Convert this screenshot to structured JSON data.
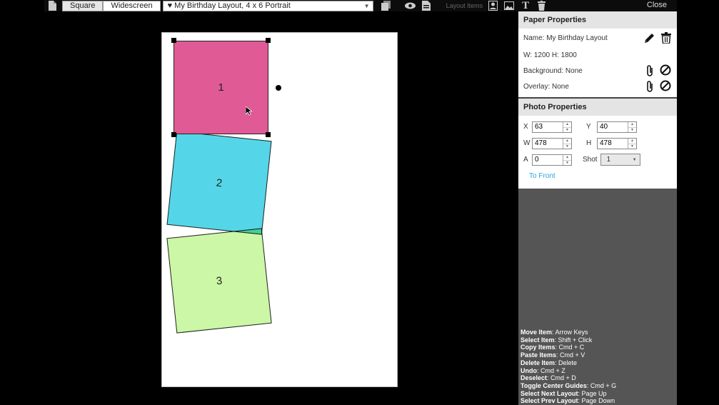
{
  "toolbar": {
    "square_label": "Square",
    "widescreen_label": "Widescreen",
    "layout_selected": "♥ My Birthday Layout, 4 x 6 Portrait",
    "layout_items_label": "Layout Items",
    "close_label": "Close"
  },
  "photos": [
    {
      "number": "1",
      "color": "#e05a96"
    },
    {
      "number": "2",
      "color": "#55d6e8"
    },
    {
      "number": "3",
      "color": "#ccf7a6"
    }
  ],
  "paper_properties": {
    "header": "Paper Properties",
    "name": "Name: My Birthday Layout",
    "dimensions": "W: 1200 H: 1800",
    "background": "Background: None",
    "overlay": "Overlay: None"
  },
  "photo_properties": {
    "header": "Photo Properties",
    "x_label": "X",
    "x_value": "63",
    "y_label": "Y",
    "y_value": "40",
    "w_label": "W",
    "w_value": "478",
    "h_label": "H",
    "h_value": "478",
    "a_label": "A",
    "a_value": "0",
    "shot_label": "Shot",
    "shot_value": "1",
    "to_front_label": "To Front"
  },
  "shortcuts": [
    {
      "action": "Move Item",
      "keys": ": Arrow Keys"
    },
    {
      "action": "Select Item",
      "keys": ": Shift + Click"
    },
    {
      "action": "Copy Items",
      "keys": ": Cmd + C"
    },
    {
      "action": "Paste Items",
      "keys": ": Cmd + V"
    },
    {
      "action": "Delete Item",
      "keys": ": Delete"
    },
    {
      "action": "Undo",
      "keys": ": Cmd + Z"
    },
    {
      "action": "Deselect",
      "keys": ": Cmd + D"
    },
    {
      "action": "Toggle Center Guides",
      "keys": ": Cmd + G"
    },
    {
      "action": "Select Next Layout",
      "keys": ": Page Up"
    },
    {
      "action": "Select Prev Layout",
      "keys": ": Page Down"
    }
  ]
}
